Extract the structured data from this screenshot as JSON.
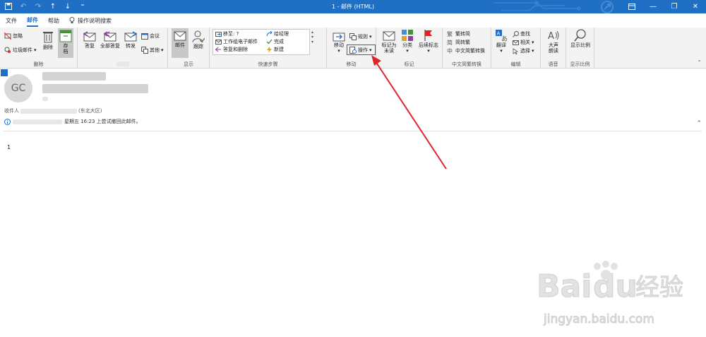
{
  "titlebar": {
    "title": "1 - 邮件 (HTML)",
    "minimize": "—",
    "restore": "❐",
    "close": "✕"
  },
  "tabs": {
    "file": "文件",
    "mail": "邮件",
    "help": "帮助",
    "tell_me": "操作说明搜索"
  },
  "ribbon": {
    "delete_group": {
      "label": "删除",
      "ignore": "忽略",
      "junk": "垃圾邮件",
      "delete": "删除",
      "archive": "存档"
    },
    "respond_group": {
      "label": "响应",
      "reply": "答复",
      "reply_all": "全部答复",
      "forward": "转发",
      "meeting": "会议",
      "more": "其他"
    },
    "show_group": {
      "label": "显示",
      "mail": "邮件",
      "track": "跟踪"
    },
    "quick_steps": {
      "label": "快速步骤",
      "move_to": "移至: ?",
      "team_email": "工作组电子邮件",
      "reply_delete": "答复和删除",
      "to_manager": "给经理",
      "done": "完成",
      "create_new": "新建"
    },
    "move_group": {
      "label": "移动",
      "move": "移动",
      "rules": "规则",
      "actions": "操作"
    },
    "tags_group": {
      "label": "标记",
      "mark_unread": "标记为\n未读",
      "categorize": "分类",
      "follow_up": "后续标志"
    },
    "chinese_group": {
      "label": "中文简繁转换",
      "to_simplified": "繁转简",
      "to_traditional": "简转繁",
      "convert": "中文简繁转换"
    },
    "edit_group": {
      "label": "编辑",
      "translate": "翻译",
      "find": "查找",
      "related": "相关",
      "select": "选择"
    },
    "speech_group": {
      "label": "语音",
      "read_aloud": "大声\n朗读"
    },
    "zoom_group": {
      "label": "显示比例",
      "zoom": "显示比例"
    }
  },
  "message": {
    "avatar_initials": "GC",
    "to_prefix": "收件人",
    "to_suffix": "(东北大区)",
    "recall_notice": "星期五 16:23 上尝试撤回此邮件。",
    "body": "1"
  },
  "colors": {
    "titlebar": "#1f6fc4",
    "accent": "#1f6fc4",
    "highlight": "#e0242a"
  },
  "watermark": {
    "brand": "Bai",
    "brand2": "du",
    "brand_cn": "经验",
    "url": "jingyan.baidu.com"
  }
}
